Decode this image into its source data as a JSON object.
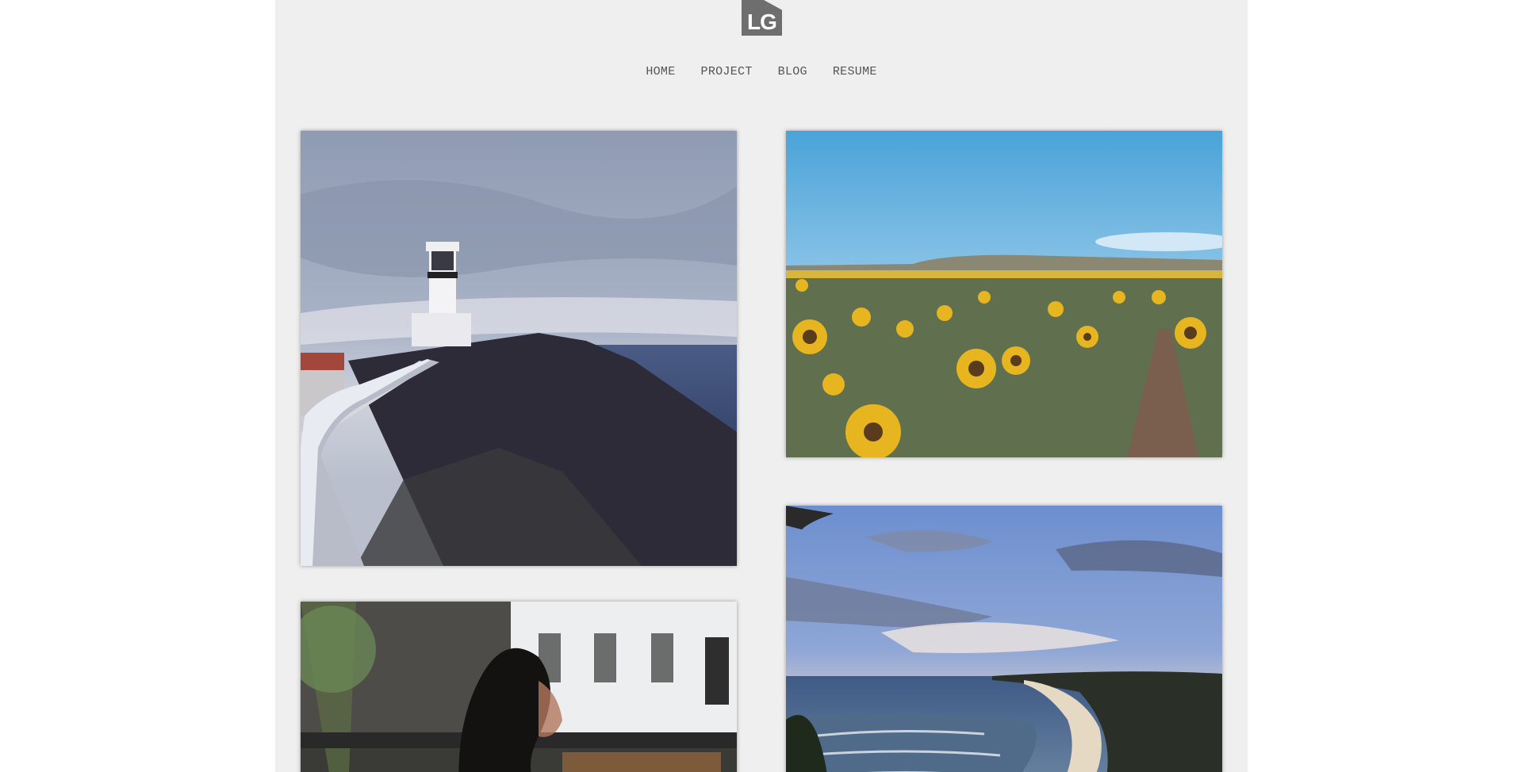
{
  "logo": {
    "text": "LG"
  },
  "nav": {
    "items": [
      {
        "label": "HOME"
      },
      {
        "label": "PROJECT"
      },
      {
        "label": "BLOG"
      },
      {
        "label": "RESUME"
      }
    ]
  },
  "gallery": {
    "photos": [
      {
        "subject": "lighthouse-on-headland"
      },
      {
        "subject": "sunflower-field"
      },
      {
        "subject": "street-building-with-passerby"
      },
      {
        "subject": "coastline-beach-at-dusk"
      }
    ]
  },
  "colors": {
    "page_background": "#efefef",
    "logo": "#6e6e6e",
    "nav_text": "#555555"
  }
}
